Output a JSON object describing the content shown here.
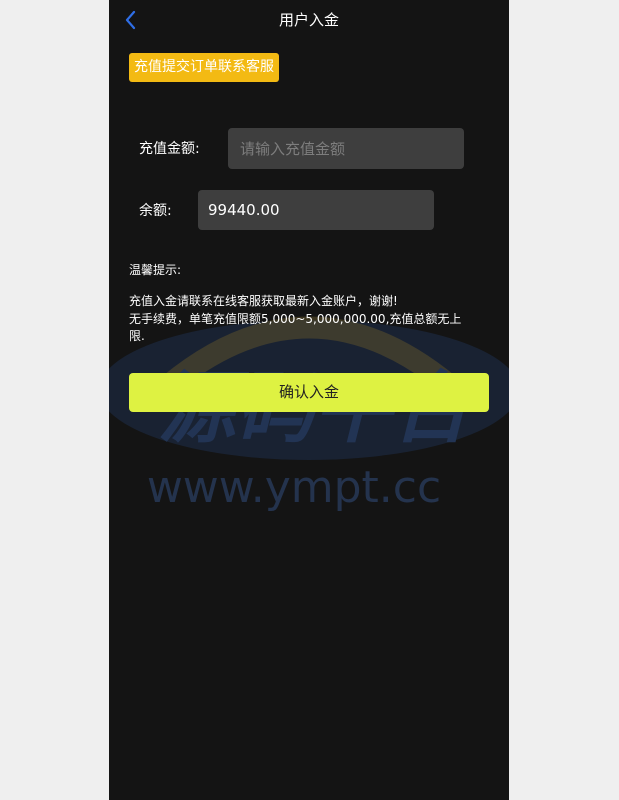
{
  "header": {
    "title": "用户入金",
    "back_icon": "chevron-left-icon"
  },
  "notice_button": "充值提交订单联系客服",
  "form": {
    "amount_label": "充值金额:",
    "amount_placeholder": "请输入充值金额",
    "amount_value": "",
    "balance_label": "余额:",
    "balance_value": "99440.00"
  },
  "tips": {
    "title": "温馨提示:",
    "line1": "充值入金请联系在线客服获取最新入金账户，谢谢!",
    "line2": "无手续费，单笔充值限额5,000~5,000,000.00,充值总额无上",
    "line3": "限."
  },
  "confirm_button": "确认入金",
  "watermark": {
    "text_cn": "源码平台",
    "text_url": "www.ympt.cc"
  },
  "colors": {
    "notice": "#f3ba13",
    "confirm": "#def242",
    "back_icon": "#2f6ee6",
    "background": "#141414"
  }
}
